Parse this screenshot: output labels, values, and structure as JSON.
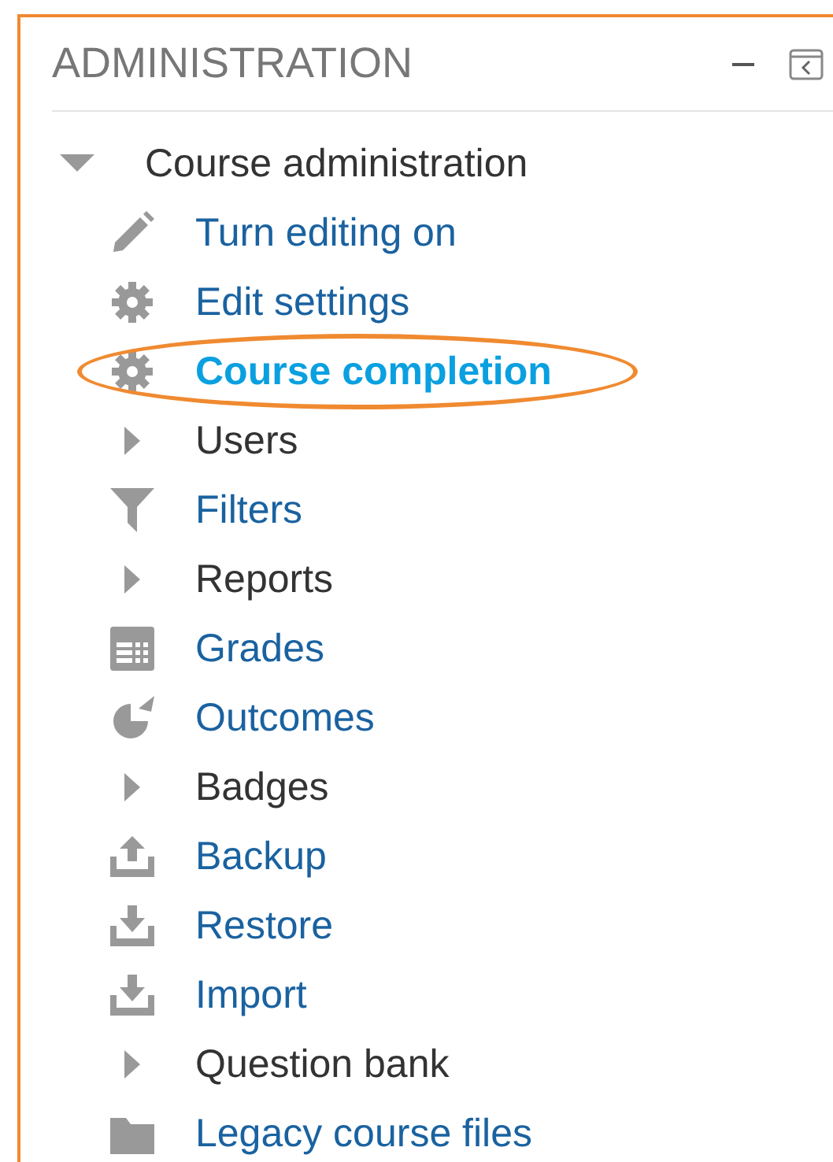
{
  "block": {
    "title": "ADMINISTRATION"
  },
  "tree": {
    "label": "Course administration",
    "expanded": true,
    "items": [
      {
        "label": "Turn editing on",
        "kind": "pencil",
        "highlighted": false
      },
      {
        "label": "Edit settings",
        "kind": "gear",
        "highlighted": false
      },
      {
        "label": "Course completion",
        "kind": "gear",
        "highlighted": true
      },
      {
        "label": "Users",
        "kind": "branch",
        "highlighted": false
      },
      {
        "label": "Filters",
        "kind": "filter",
        "highlighted": false
      },
      {
        "label": "Reports",
        "kind": "branch",
        "highlighted": false
      },
      {
        "label": "Grades",
        "kind": "table",
        "highlighted": false
      },
      {
        "label": "Outcomes",
        "kind": "pie",
        "highlighted": false
      },
      {
        "label": "Badges",
        "kind": "branch",
        "highlighted": false
      },
      {
        "label": "Backup",
        "kind": "upload",
        "highlighted": false
      },
      {
        "label": "Restore",
        "kind": "download",
        "highlighted": false
      },
      {
        "label": "Import",
        "kind": "download",
        "highlighted": false
      },
      {
        "label": "Question bank",
        "kind": "branch",
        "highlighted": false
      },
      {
        "label": "Legacy course files",
        "kind": "folder",
        "highlighted": false
      }
    ]
  }
}
